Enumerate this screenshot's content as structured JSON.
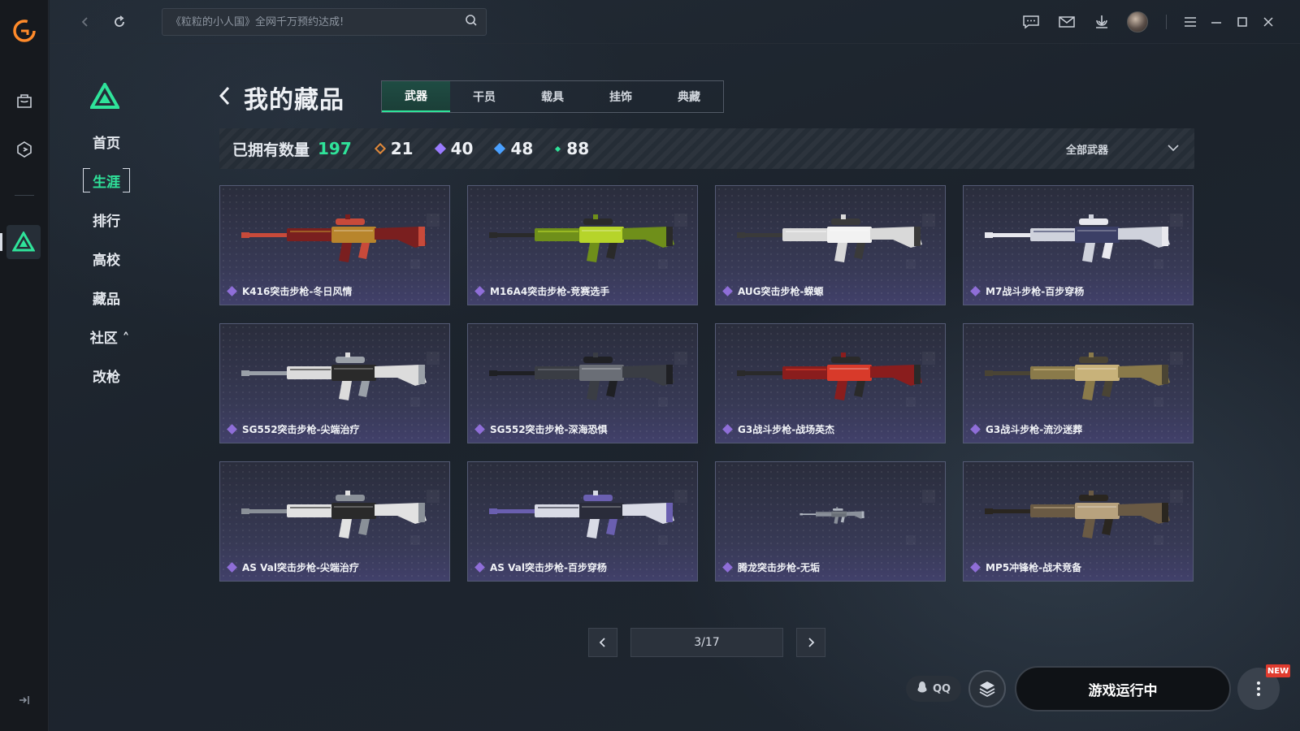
{
  "topbar": {
    "search_placeholder": "《粒粒的小人国》全网千万预约达成!"
  },
  "sidebar": {
    "items": [
      {
        "label": "首页"
      },
      {
        "label": "生涯",
        "active": true
      },
      {
        "label": "排行"
      },
      {
        "label": "高校"
      },
      {
        "label": "藏品"
      },
      {
        "label": "社区 ˄"
      },
      {
        "label": "改枪"
      }
    ]
  },
  "header": {
    "title": "我的藏品",
    "tabs": [
      {
        "label": "武器",
        "active": true
      },
      {
        "label": "干员"
      },
      {
        "label": "载具"
      },
      {
        "label": "挂饰"
      },
      {
        "label": "典藏"
      }
    ]
  },
  "stats": {
    "owned_label": "已拥有数量",
    "total": "197",
    "counts": [
      {
        "value": "21",
        "color": "#e0883a"
      },
      {
        "value": "40",
        "color": "#9a7bff"
      },
      {
        "value": "48",
        "color": "#4aa0ff"
      },
      {
        "value": "88",
        "color": "#2fe39a"
      }
    ],
    "filter_label": "全部武器"
  },
  "items": [
    {
      "name": "K416突击步枪-冬日风情",
      "colors": [
        "#7a1f1f",
        "#b8852c",
        "#c84a3a"
      ]
    },
    {
      "name": "M16A4突击步枪-竞赛选手",
      "colors": [
        "#6f8f1a",
        "#b6d42a",
        "#2a2a2a"
      ]
    },
    {
      "name": "AUG突击步枪-蝾螈",
      "colors": [
        "#d9d9d9",
        "#f2f2f2",
        "#3a3a3a"
      ]
    },
    {
      "name": "M7战斗步枪-百步穿杨",
      "colors": [
        "#cfd2dc",
        "#3b3f66",
        "#e8e8ee"
      ]
    },
    {
      "name": "SG552突击步枪-尖端治疗",
      "colors": [
        "#dcdcdc",
        "#2a2a2a",
        "#9aa0a8"
      ]
    },
    {
      "name": "SG552突击步枪-深海恐惧",
      "colors": [
        "#3a3d44",
        "#6a6e76",
        "#1f2024"
      ]
    },
    {
      "name": "G3战斗步枪-战场英杰",
      "colors": [
        "#8a1d1d",
        "#d83a2a",
        "#2a2a2a"
      ]
    },
    {
      "name": "G3战斗步枪-流沙迷葬",
      "colors": [
        "#8a7a4a",
        "#c8b27a",
        "#4a4434"
      ]
    },
    {
      "name": "AS Val突击步枪-尖端治疗",
      "colors": [
        "#e2e2e2",
        "#2a2a2a",
        "#8a9098"
      ]
    },
    {
      "name": "AS Val突击步枪-百步穿杨",
      "colors": [
        "#d9dbe6",
        "#2a2c3a",
        "#6a5fb0"
      ]
    },
    {
      "name": "腾龙突击步枪-无垢",
      "colors": [
        "#8a909a",
        "#6a7078",
        "#b0b6c0"
      ]
    },
    {
      "name": "MP5冲锋枪-战术竞备",
      "colors": [
        "#6a5a44",
        "#b8a27e",
        "#2a2620"
      ]
    }
  ],
  "pager": {
    "page_text": "3/17"
  },
  "footer": {
    "qq_label": "QQ",
    "run_label": "游戏运行中",
    "new_badge": "NEW"
  }
}
